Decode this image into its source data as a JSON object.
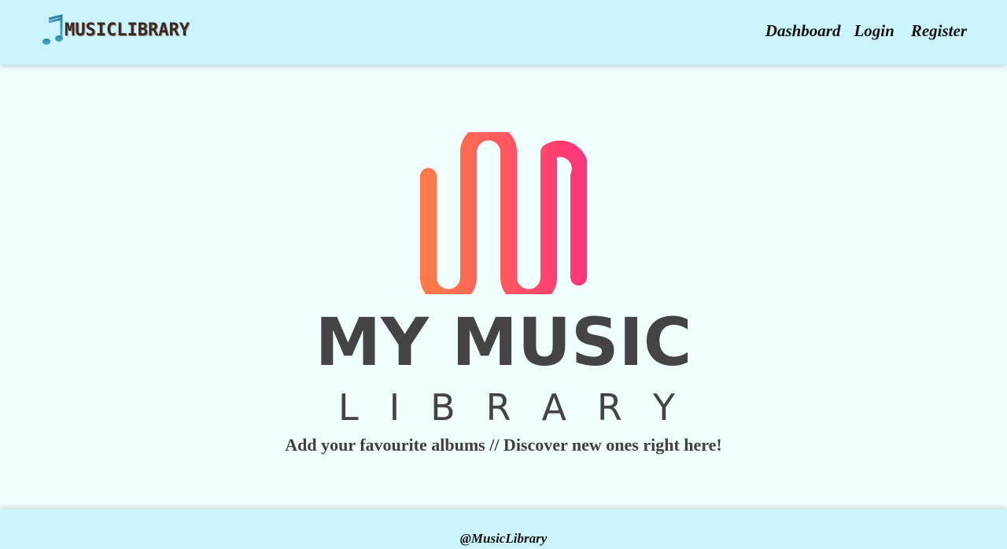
{
  "header": {
    "brand_name": "MUSICLIBRARY",
    "brand_icon": "music-note-icon",
    "nav": {
      "dashboard": "Dashboard",
      "login": "Login",
      "register": "Register"
    }
  },
  "hero": {
    "logo_title": "MY MUSIC",
    "logo_subtitle_letters": [
      "L",
      "I",
      "B",
      "R",
      "A",
      "R",
      "Y"
    ],
    "tagline": "Add your favourite albums // Discover new ones right here!"
  },
  "footer": {
    "text": "@MusicLibrary"
  },
  "colors": {
    "header_bg": "#cbf4fd",
    "page_bg": "#f1fefe",
    "logo_gradient_start": "#ff7a48",
    "logo_gradient_end": "#ff3579",
    "logo_text": "#444444"
  }
}
